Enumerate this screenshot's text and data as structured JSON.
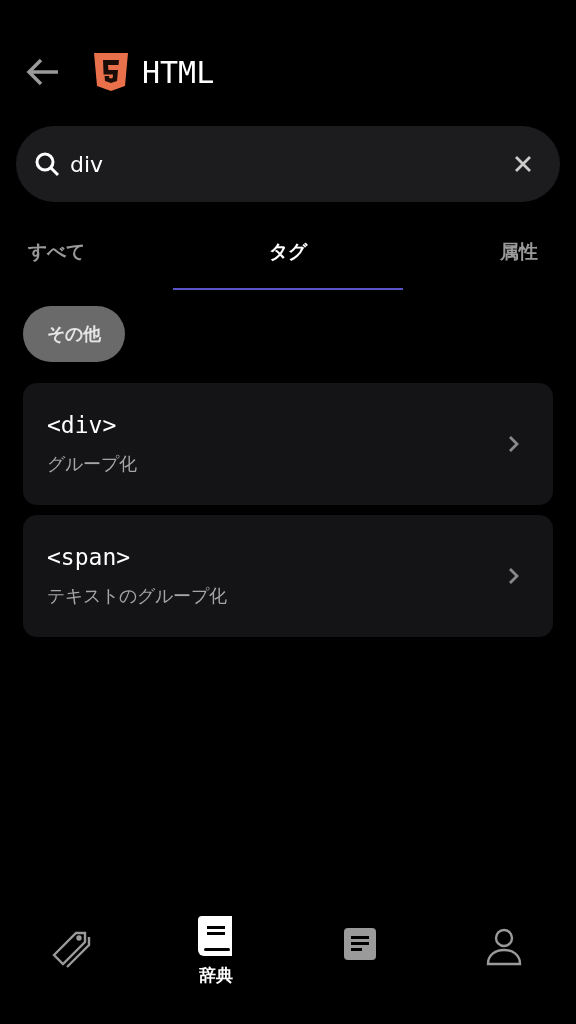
{
  "header": {
    "title": "HTML"
  },
  "search": {
    "value": "div"
  },
  "tabs": [
    {
      "label": "すべて",
      "selected": false
    },
    {
      "label": "タグ",
      "selected": true
    },
    {
      "label": "属性",
      "selected": false
    }
  ],
  "chips": [
    {
      "label": "その他",
      "selected": true
    }
  ],
  "results": [
    {
      "name": "<div>",
      "description": "グループ化"
    },
    {
      "name": "<span>",
      "description": "テキストのグループ化"
    }
  ],
  "nav": [
    {
      "kind": "tags",
      "selected": false
    },
    {
      "kind": "book",
      "label": "辞典",
      "selected": true
    },
    {
      "kind": "note",
      "selected": false
    },
    {
      "kind": "person",
      "selected": false
    }
  ]
}
